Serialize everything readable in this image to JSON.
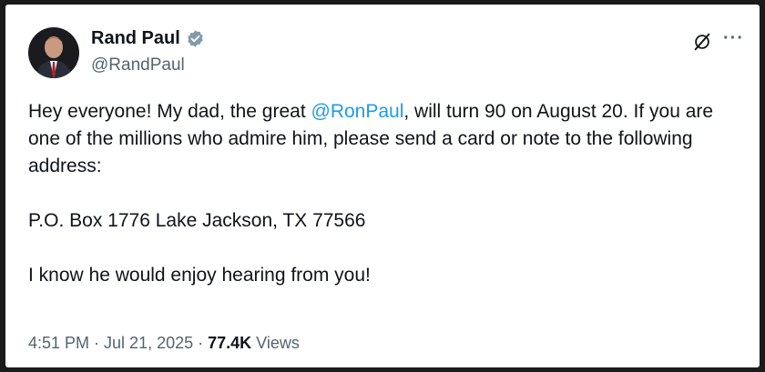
{
  "author": {
    "display_name": "Rand Paul",
    "handle": "@RandPaul",
    "verified_color": "#829aab"
  },
  "icons": {
    "grok": "grok-icon",
    "more": "more-icon",
    "verified": "verified-badge-icon"
  },
  "more_glyph": "···",
  "tweet": {
    "line1_pre": "Hey everyone! My dad, the great ",
    "mention": "@RonPaul",
    "line1_post": ", will turn 90 on August 20.  If you are one of the millions who admire him, please send a card or note to the following address:",
    "address": "P.O. Box 1776 Lake Jackson, TX 77566",
    "closing": "I know he would enjoy hearing from you!"
  },
  "meta": {
    "time": "4:51 PM",
    "sep1": " · ",
    "date": "Jul 21, 2025",
    "sep2": " · ",
    "views_count": "77.4K",
    "views_label": " Views"
  },
  "colors": {
    "mention": "#1d9bf0",
    "text": "#0f1419",
    "secondary": "#536471"
  }
}
